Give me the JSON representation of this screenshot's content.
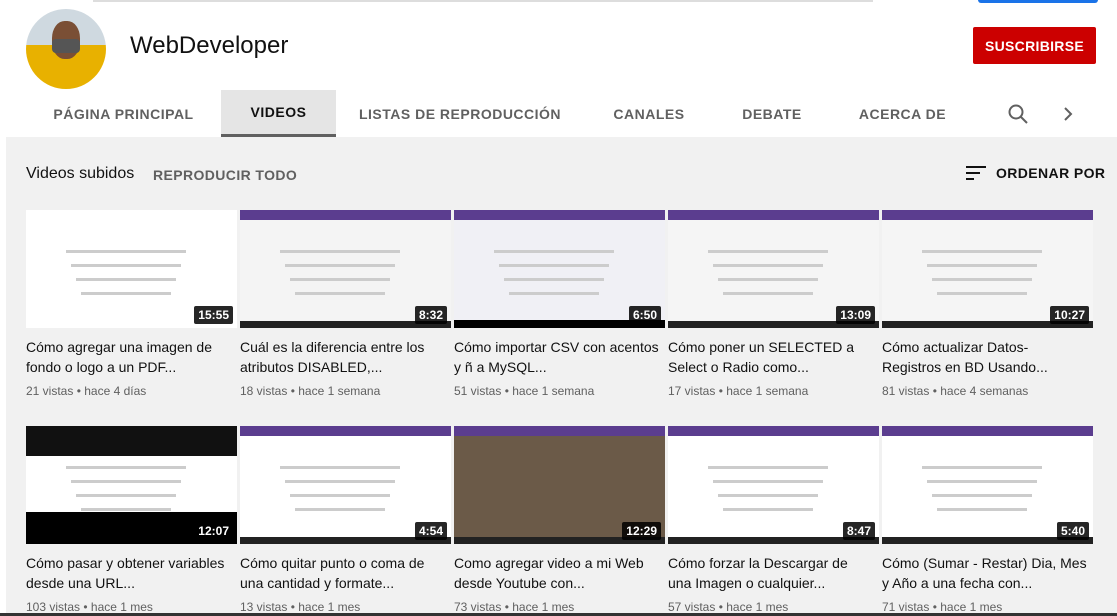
{
  "channel": {
    "name": "WebDeveloper",
    "subscribe_label": "SUSCRIBIRSE"
  },
  "tabs": [
    {
      "label": "PÁGINA PRINCIPAL",
      "active": false
    },
    {
      "label": "VIDEOS",
      "active": true
    },
    {
      "label": "LISTAS DE REPRODUCCIÓN",
      "active": false
    },
    {
      "label": "CANALES",
      "active": false
    },
    {
      "label": "DEBATE",
      "active": false
    },
    {
      "label": "ACERCA DE",
      "active": false
    }
  ],
  "icons": {
    "search": "search-icon",
    "next": "chevron-right-icon",
    "sort": "sort-icon"
  },
  "section": {
    "title": "Videos subidos",
    "play_all": "REPRODUCIR TODO",
    "sort_label": "ORDENAR POR"
  },
  "videos": [
    {
      "title": "Cómo agregar una imagen de fondo o logo a un PDF...",
      "meta": "21 vistas • hace 4 días",
      "duration": "15:55"
    },
    {
      "title": "Cuál es la diferencia entre los atributos DISABLED,...",
      "meta": "18 vistas • hace 1 semana",
      "duration": "8:32"
    },
    {
      "title": "Cómo importar CSV con acentos y ñ a MySQL...",
      "meta": "51 vistas • hace 1 semana",
      "duration": "6:50"
    },
    {
      "title": "Cómo poner un SELECTED a Select o Radio como...",
      "meta": "17 vistas • hace 1 semana",
      "duration": "13:09"
    },
    {
      "title": "Cómo actualizar Datos-Registros en BD Usando...",
      "meta": "81 vistas • hace 4 semanas",
      "duration": "10:27"
    },
    {
      "title": "Cómo pasar y obtener variables desde una URL...",
      "meta": "103 vistas • hace 1 mes",
      "duration": "12:07"
    },
    {
      "title": "Cómo quitar punto o coma de una cantidad y formate...",
      "meta": "13 vistas • hace 1 mes",
      "duration": "4:54"
    },
    {
      "title": "Como agregar video a mi Web desde Youtube con...",
      "meta": "73 vistas • hace 1 mes",
      "duration": "12:29"
    },
    {
      "title": "Cómo forzar la Descargar de una Imagen o cualquier...",
      "meta": "57 vistas • hace 1 mes",
      "duration": "8:47"
    },
    {
      "title": "Cómo (Sumar - Restar) Dia, Mes y Año a una fecha con...",
      "meta": "71 vistas • hace 1 mes",
      "duration": "5:40"
    }
  ]
}
